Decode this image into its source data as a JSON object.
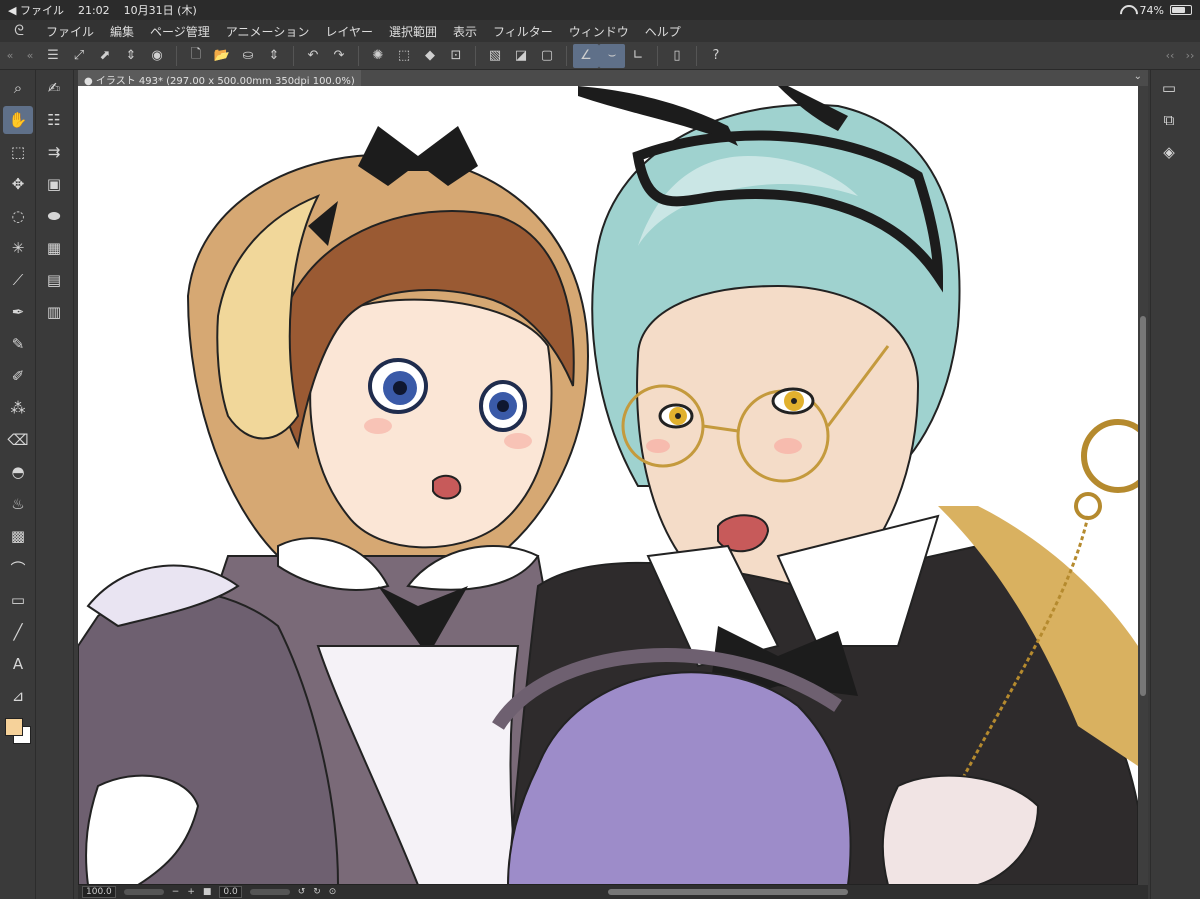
{
  "status_bar": {
    "back_app": "◀ ファイル",
    "time": "21:02",
    "date": "10月31日 (木)",
    "battery": "74%",
    "battery_level": 0.74
  },
  "menu": {
    "items": [
      "ファイル",
      "編集",
      "ページ管理",
      "アニメーション",
      "レイヤー",
      "選択範囲",
      "表示",
      "フィルター",
      "ウィンドウ",
      "ヘルプ"
    ]
  },
  "document": {
    "tab_title": "● イラスト 493* (297.00 x 500.00mm 350dpi 100.0%)"
  },
  "bottom": {
    "zoom": "100.0",
    "rotation": "0.0"
  },
  "colors": {
    "main_color": "#f6d29a",
    "sub_color": "#ffffff",
    "active_tool": "#5f7089"
  },
  "icons": {
    "left_tools": [
      "search-icon",
      "hand-icon",
      "select-layer-icon",
      "move-icon",
      "lasso-icon",
      "magic-wand-icon",
      "eyedropper-icon",
      "pen-icon",
      "pencil-icon",
      "marker-icon",
      "airbrush-icon",
      "eraser-icon",
      "fill-icon",
      "blend-icon",
      "decoration-icon",
      "curve-icon",
      "gradient-icon",
      "line-icon",
      "text-icon",
      "ruler-icon"
    ],
    "sub_tools": [
      "brush-tool-icon",
      "adjust-icon",
      "transform-icon",
      "material-icon",
      "layer-property-icon",
      "navigator-icon",
      "timeline-icon",
      "calendar-icon"
    ]
  }
}
